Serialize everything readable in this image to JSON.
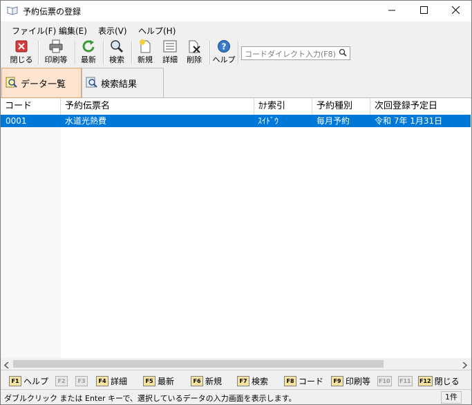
{
  "window": {
    "title": "予約伝票の登録"
  },
  "menu": [
    {
      "label": "ファイル(F)"
    },
    {
      "label": "編集(E)"
    },
    {
      "label": "表示(V)"
    },
    {
      "label": "ヘルプ(H)"
    }
  ],
  "toolbar": {
    "close": "閉じる",
    "print": "印刷等",
    "refresh": "最新",
    "search": "検索",
    "new": "新規",
    "detail": "詳細",
    "delete": "削除",
    "help": "ヘルプ",
    "search_placeholder": "コードダイレクト入力(F8)"
  },
  "tabs": [
    {
      "label": "データ一覧",
      "active": true
    },
    {
      "label": "検索結果",
      "active": false
    }
  ],
  "grid": {
    "columns": [
      "コード",
      "予約伝票名",
      "ｶﾅ索引",
      "予約種別",
      "次回登録予定日"
    ],
    "rows": [
      {
        "code": "0001",
        "name": "水道光熱費",
        "kana": "ｽｲﾄﾞｳ",
        "type": "毎月予約",
        "next": "令和  7年  1月31日"
      }
    ]
  },
  "fkeys": [
    {
      "key": "F1",
      "label": "ヘルプ",
      "enabled": true
    },
    {
      "key": "F2",
      "label": "",
      "enabled": false
    },
    {
      "key": "F3",
      "label": "",
      "enabled": false
    },
    {
      "key": "F4",
      "label": "詳細",
      "enabled": true
    },
    {
      "key": "F5",
      "label": "最新",
      "enabled": true
    },
    {
      "key": "F6",
      "label": "新規",
      "enabled": true
    },
    {
      "key": "F7",
      "label": "検索",
      "enabled": true
    },
    {
      "key": "F8",
      "label": "コード",
      "enabled": true
    },
    {
      "key": "F9",
      "label": "印刷等",
      "enabled": true
    },
    {
      "key": "F10",
      "label": "",
      "enabled": false
    },
    {
      "key": "F11",
      "label": "",
      "enabled": false
    },
    {
      "key": "F12",
      "label": "閉じる",
      "enabled": true
    }
  ],
  "status": {
    "message": "ダブルクリック または Enter キーで、選択しているデータの入力画面を表示します。",
    "count": "1件"
  }
}
